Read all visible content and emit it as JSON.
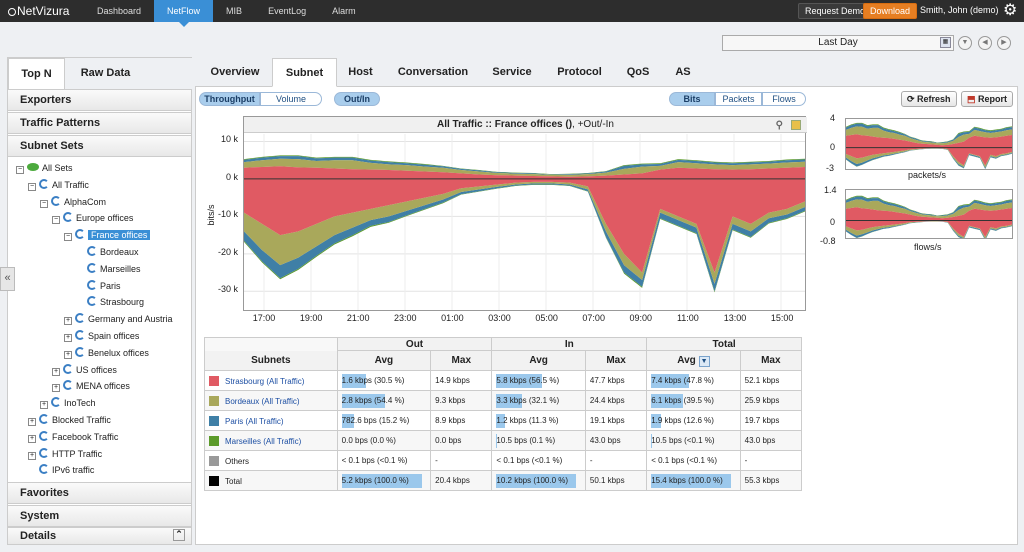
{
  "app": {
    "logo": "NetVizura"
  },
  "topnav": {
    "items": [
      "Dashboard",
      "NetFlow",
      "MIB",
      "EventLog",
      "Alarm"
    ],
    "active": 1
  },
  "topbar": {
    "request_demo": "Request Demo",
    "download": "Download",
    "user": "Smith, John (demo)"
  },
  "daterange": {
    "value": "Last Day"
  },
  "sidebar": {
    "tabs": [
      "Top N",
      "Raw Data"
    ],
    "sections": [
      "Exporters",
      "Traffic Patterns",
      "Subnet Sets"
    ],
    "tree": [
      {
        "label": "All Sets",
        "level": 0,
        "toggle": "−",
        "icon": "eye"
      },
      {
        "label": "All Traffic",
        "level": 1,
        "toggle": "−",
        "icon": "sync"
      },
      {
        "label": "AlphaCom",
        "level": 2,
        "toggle": "−",
        "icon": "sync"
      },
      {
        "label": "Europe offices",
        "level": 3,
        "toggle": "−",
        "icon": "sync"
      },
      {
        "label": "France offices",
        "level": 4,
        "toggle": "−",
        "icon": "sync",
        "selected": true
      },
      {
        "label": "Bordeaux",
        "level": 5,
        "toggle": "",
        "icon": "sync"
      },
      {
        "label": "Marseilles",
        "level": 5,
        "toggle": "",
        "icon": "sync"
      },
      {
        "label": "Paris",
        "level": 5,
        "toggle": "",
        "icon": "sync"
      },
      {
        "label": "Strasbourg",
        "level": 5,
        "toggle": "",
        "icon": "sync"
      },
      {
        "label": "Germany and Austria",
        "level": 4,
        "toggle": "+",
        "icon": "sync"
      },
      {
        "label": "Spain offices",
        "level": 4,
        "toggle": "+",
        "icon": "sync"
      },
      {
        "label": "Benelux offices",
        "level": 4,
        "toggle": "+",
        "icon": "sync"
      },
      {
        "label": "US offices",
        "level": 3,
        "toggle": "+",
        "icon": "sync"
      },
      {
        "label": "MENA offices",
        "level": 3,
        "toggle": "+",
        "icon": "sync"
      },
      {
        "label": "InoTech",
        "level": 2,
        "toggle": "+",
        "icon": "sync"
      },
      {
        "label": "Blocked Traffic",
        "level": 1,
        "toggle": "+",
        "icon": "sync"
      },
      {
        "label": "Facebook Traffic",
        "level": 1,
        "toggle": "+",
        "icon": "sync"
      },
      {
        "label": "HTTP Traffic",
        "level": 1,
        "toggle": "+",
        "icon": "sync"
      },
      {
        "label": "IPv6 traffic",
        "level": 1,
        "toggle": "",
        "icon": "sync"
      }
    ],
    "bottom_sections": [
      "Favorites",
      "System",
      "Details"
    ]
  },
  "main": {
    "tabs": [
      "Overview",
      "Subnet",
      "Host",
      "Conversation",
      "Service",
      "Protocol",
      "QoS",
      "AS"
    ],
    "active_tab": 1,
    "measure": {
      "options": [
        "Throughput",
        "Volume"
      ],
      "active": 0
    },
    "direction": {
      "label": "Out/In"
    },
    "unit": {
      "options": [
        "Bits",
        "Packets",
        "Flows"
      ],
      "active": 0
    },
    "refresh": "Refresh",
    "report": "Report"
  },
  "chart_data": [
    {
      "type": "area",
      "title": "All Traffic :: France offices ()",
      "subtitle": ", +Out/-In",
      "ylabel": "bits/s",
      "ylim": [
        -35000,
        12000
      ],
      "yticks": [
        "10 k",
        "0 k",
        "-10 k",
        "-20 k",
        "-30 k"
      ],
      "xticks": [
        "17:00",
        "19:00",
        "21:00",
        "23:00",
        "01:00",
        "03:00",
        "05:00",
        "07:00",
        "09:00",
        "11:00",
        "13:00",
        "15:00"
      ],
      "series": [
        {
          "name": "Strasbourg",
          "color": "#e05a63"
        },
        {
          "name": "Bordeaux",
          "color": "#a9a85b"
        },
        {
          "name": "Paris",
          "color": "#3f7fa6"
        },
        {
          "name": "Marseilles",
          "color": "#5b9a2a"
        }
      ],
      "out": [
        [
          3000,
          3200,
          3400,
          3100,
          3000,
          2800,
          2600,
          2500,
          2400,
          2200,
          2000,
          1800,
          1500,
          1200,
          1000,
          900,
          800,
          700,
          600,
          700,
          900,
          1200,
          1500,
          2500,
          3000,
          2800,
          2600,
          2500,
          2600,
          2800,
          3000,
          3200
        ],
        [
          1500,
          1800,
          2000,
          2200,
          1800,
          2200,
          2400,
          1800,
          1500,
          1500,
          1300,
          1200,
          900,
          800,
          600,
          500,
          500,
          400,
          500,
          600,
          800,
          1500,
          1800,
          1000,
          1500,
          1400,
          1300,
          1200,
          1300,
          1300,
          1400,
          1400
        ],
        [
          600,
          700,
          700,
          800,
          700,
          700,
          700,
          600,
          600,
          500,
          500,
          400,
          300,
          300,
          200,
          200,
          200,
          100,
          200,
          200,
          300,
          800,
          600,
          500,
          600,
          600,
          500,
          500,
          500,
          500,
          600,
          600
        ],
        [
          200,
          200,
          200,
          200,
          200,
          200,
          200,
          200,
          200,
          200,
          200,
          100,
          100,
          100,
          100,
          100,
          100,
          100,
          100,
          100,
          100,
          200,
          200,
          200,
          200,
          200,
          200,
          200,
          200,
          200,
          200,
          200
        ]
      ],
      "in": [
        [
          -9000,
          -12000,
          -15000,
          -14000,
          -12000,
          -10000,
          -9000,
          -8000,
          -7000,
          -6000,
          -5000,
          -4000,
          -2500,
          -2000,
          -1500,
          -1000,
          -800,
          -800,
          -1000,
          -2000,
          -12000,
          -20000,
          -25000,
          -8000,
          -10000,
          -12000,
          -25000,
          -10000,
          -12000,
          -9000,
          -8000,
          -6000
        ],
        [
          -5000,
          -7000,
          -8000,
          -7000,
          -6000,
          -5000,
          -4000,
          -3000,
          -3000,
          -2500,
          -2000,
          -1500,
          -1000,
          -800,
          -600,
          -500,
          -400,
          -400,
          -500,
          -800,
          -2000,
          -3000,
          -2000,
          -1000,
          -1000,
          -1000,
          -3000,
          -2000,
          -2000,
          -1500,
          -1500,
          -1500
        ],
        [
          -2500,
          -3000,
          -3500,
          -3000,
          -2500,
          -2200,
          -2000,
          -1500,
          -1500,
          -1200,
          -1000,
          -800,
          -600,
          -500,
          -400,
          -300,
          -300,
          -300,
          -300,
          -500,
          -1500,
          -2000,
          -1800,
          -1500,
          -1500,
          -1500,
          -2000,
          -1500,
          -1500,
          -1200,
          -1000,
          -1000
        ],
        [
          -300,
          -300,
          -300,
          -300,
          -300,
          -300,
          -300,
          -300,
          -200,
          -200,
          -200,
          -200,
          -100,
          -100,
          -100,
          -100,
          -100,
          -100,
          -100,
          -100,
          -200,
          -300,
          -300,
          -200,
          -200,
          -200,
          -300,
          -200,
          -200,
          -200,
          -200,
          -200
        ]
      ]
    },
    {
      "type": "area",
      "xlabel": "packets/s",
      "yticks": [
        "4",
        "0",
        "-3"
      ],
      "ylim": [
        -3,
        4
      ]
    },
    {
      "type": "area",
      "xlabel": "flows/s",
      "yticks": [
        "1.4",
        "0",
        "-0.8"
      ],
      "ylim": [
        -0.8,
        1.4
      ]
    }
  ],
  "table": {
    "groups": [
      "Out",
      "In",
      "Total"
    ],
    "subhead": [
      "Subnets",
      "Avg",
      "Max",
      "Avg",
      "Max",
      "Avg",
      "Max"
    ],
    "rows": [
      {
        "name": "Strasbourg (All Traffic)",
        "color": "#e05a63",
        "link": true,
        "out_avg": "1.6 kbps (30.5 %)",
        "out_pct": 30.5,
        "out_max": "14.9 kbps",
        "in_avg": "5.8 kbps (56.5 %)",
        "in_pct": 56.5,
        "in_max": "47.7 kbps",
        "tot_avg": "7.4 kbps (47.8 %)",
        "tot_pct": 47.8,
        "tot_max": "52.1 kbps"
      },
      {
        "name": "Bordeaux (All Traffic)",
        "color": "#a9a85b",
        "link": true,
        "out_avg": "2.8 kbps (54.4 %)",
        "out_pct": 54.4,
        "out_max": "9.3 kbps",
        "in_avg": "3.3 kbps (32.1 %)",
        "in_pct": 32.1,
        "in_max": "24.4 kbps",
        "tot_avg": "6.1 kbps (39.5 %)",
        "tot_pct": 39.5,
        "tot_max": "25.9 kbps"
      },
      {
        "name": "Paris (All Traffic)",
        "color": "#3f7fa6",
        "link": true,
        "out_avg": "782.6 bps (15.2 %)",
        "out_pct": 15.2,
        "out_max": "8.9 kbps",
        "in_avg": "1.2 kbps (11.3 %)",
        "in_pct": 11.3,
        "in_max": "19.1 kbps",
        "tot_avg": "1.9 kbps (12.6 %)",
        "tot_pct": 12.6,
        "tot_max": "19.7 kbps"
      },
      {
        "name": "Marseilles (All Traffic)",
        "color": "#5b9a2a",
        "link": true,
        "out_avg": "0.0 bps (0.0 %)",
        "out_pct": 0,
        "out_max": "0.0 bps",
        "in_avg": "10.5 bps (0.1 %)",
        "in_pct": 0.1,
        "in_max": "43.0 bps",
        "tot_avg": "10.5 bps (<0.1 %)",
        "tot_pct": 0.1,
        "tot_max": "43.0 bps"
      },
      {
        "name": "Others",
        "color": "#999999",
        "link": false,
        "out_avg": "< 0.1 bps (<0.1 %)",
        "out_pct": 0,
        "out_max": "-",
        "in_avg": "< 0.1 bps (<0.1 %)",
        "in_pct": 0,
        "in_max": "-",
        "tot_avg": "< 0.1 bps (<0.1 %)",
        "tot_pct": 0,
        "tot_max": "-"
      },
      {
        "name": "Total",
        "color": "#000000",
        "link": false,
        "out_avg": "5.2 kbps (100.0 %)",
        "out_pct": 100,
        "out_max": "20.4 kbps",
        "in_avg": "10.2 kbps (100.0 %)",
        "in_pct": 100,
        "in_max": "50.1 kbps",
        "tot_avg": "15.4 kbps (100.0 %)",
        "tot_pct": 100,
        "tot_max": "55.3 kbps"
      }
    ]
  }
}
